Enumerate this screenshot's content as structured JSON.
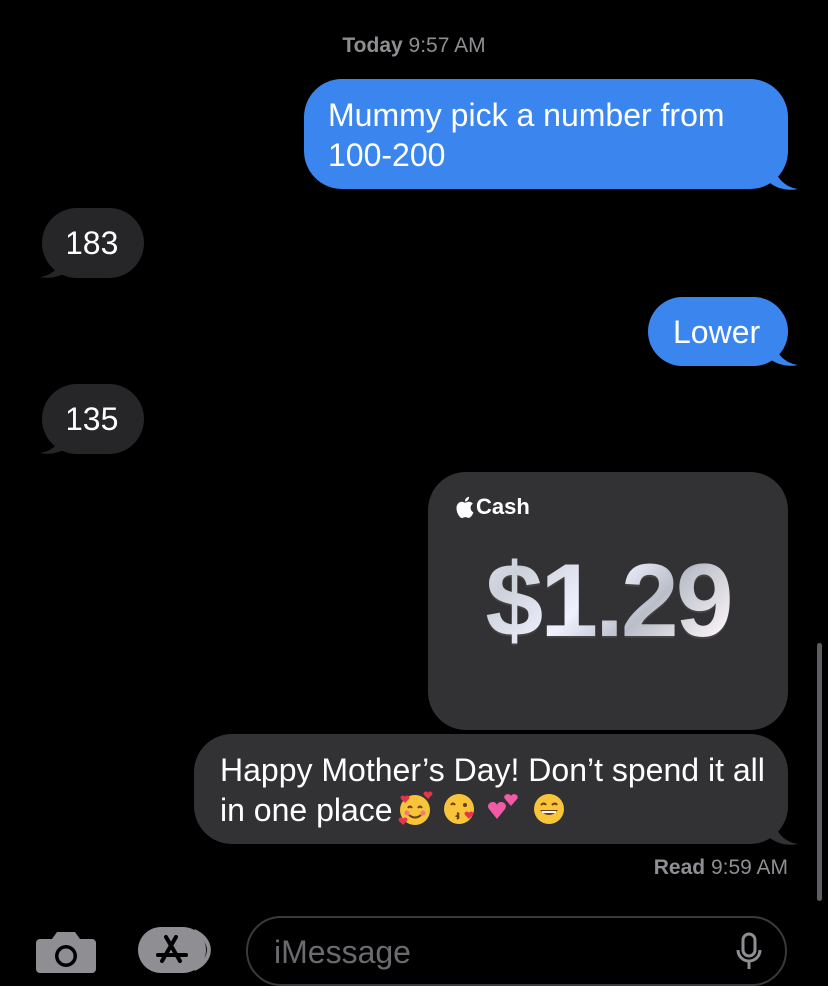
{
  "header": {
    "timestamp_day": "Today",
    "timestamp_time": "9:57 AM"
  },
  "messages": [
    {
      "direction": "sent",
      "text": "Mummy pick a number from 100-200"
    },
    {
      "direction": "received",
      "text": "183"
    },
    {
      "direction": "sent",
      "text": "Lower"
    },
    {
      "direction": "received",
      "text": "135"
    }
  ],
  "cash": {
    "brand": "Cash",
    "amount": "$1.29"
  },
  "gift_message": {
    "text": "Happy Mother’s Day! Don’t spend it all in one place",
    "emojis": [
      "smiling-face-with-hearts",
      "face-blowing-a-kiss",
      "two-hearts",
      "grinning-face-with-smiling-eyes"
    ]
  },
  "read_receipt": {
    "status": "Read",
    "time": "9:59 AM"
  },
  "composer": {
    "placeholder": "iMessage"
  },
  "colors": {
    "background": "#000000",
    "sent_bubble": "#3b86ee",
    "received_bubble": "#262628",
    "meta_text": "#8e8e93"
  }
}
